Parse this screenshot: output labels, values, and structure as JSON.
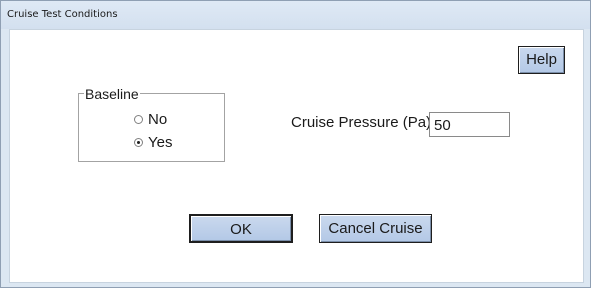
{
  "window": {
    "title": "Cruise Test Conditions"
  },
  "help_button": {
    "label": "Help"
  },
  "baseline_group": {
    "legend": "Baseline",
    "options": [
      {
        "label": "No",
        "selected": false
      },
      {
        "label": "Yes",
        "selected": true
      }
    ]
  },
  "cruise_pressure": {
    "label": "Cruise Pressure (Pa)",
    "value": "50"
  },
  "buttons": {
    "ok_label": "OK",
    "cancel_label": "Cancel Cruise"
  }
}
